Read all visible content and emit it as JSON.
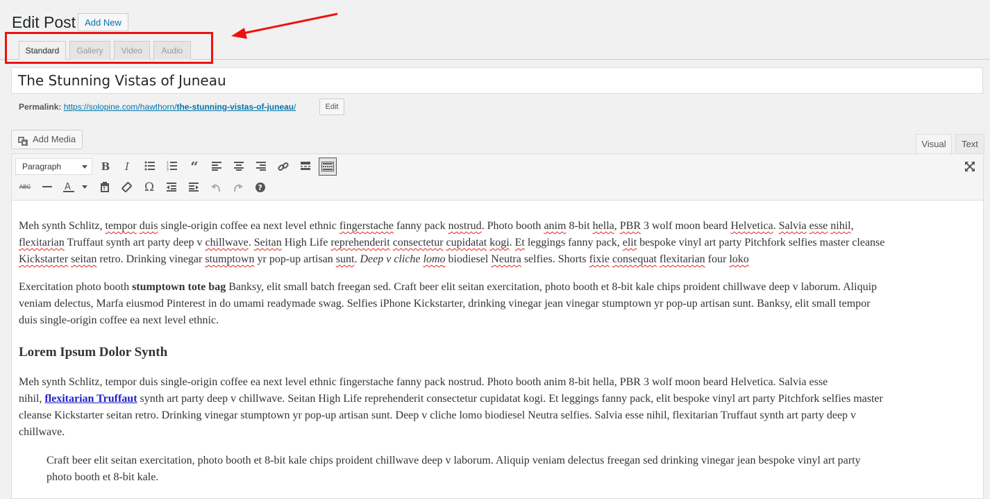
{
  "header": {
    "title": "Edit Post",
    "add_new_label": "Add New"
  },
  "format_tabs": [
    "Standard",
    "Gallery",
    "Video",
    "Audio"
  ],
  "post_title": "The Stunning Vistas of Juneau",
  "permalink": {
    "label": "Permalink:",
    "base_url": "https://solopine.com/hawthorn/",
    "slug": "the-stunning-vistas-of-juneau",
    "trailing": "/",
    "edit_label": "Edit"
  },
  "editor": {
    "add_media_label": "Add Media",
    "tab_visual": "Visual",
    "tab_text": "Text",
    "format_select": "Paragraph",
    "toolbar_row1_icons": [
      "bold-icon",
      "italic-icon",
      "bulleted-list-icon",
      "numbered-list-icon",
      "blockquote-icon",
      "align-left-icon",
      "align-center-icon",
      "align-right-icon",
      "link-icon",
      "read-more-icon",
      "toolbar-toggle-icon"
    ],
    "toolbar_row2_icons": [
      "strikethrough-icon",
      "horizontal-line-icon",
      "text-color-icon",
      "paste-as-text-icon",
      "clear-formatting-icon",
      "special-character-icon",
      "outdent-icon",
      "indent-icon",
      "undo-icon",
      "redo-icon",
      "help-icon"
    ],
    "fullscreen_icon": "fullscreen-icon"
  },
  "content": {
    "p1": {
      "t1": "Meh synth Schlitz, ",
      "s1": "tempor",
      "t2": " ",
      "s2": "duis",
      "t3": " single-origin coffee ea next level ethnic ",
      "s3": "fingerstache",
      "t4": " fanny pack ",
      "s4": "nostrud",
      "t5": ". Photo booth ",
      "s5": "anim",
      "t6": " 8-bit ",
      "s6": "hella",
      "t7": ", ",
      "s7": "PBR",
      "t8": " 3 wolf moon beard ",
      "s8": "Helvetica",
      "t9": ". ",
      "s9": "Salvia",
      "t10": " ",
      "s10": "esse",
      "t11": " ",
      "s11": "nihil",
      "t12": ",",
      "s12": "flexitarian",
      "t13": " Truffaut synth art party deep v ",
      "s13": "chillwave",
      "t14": ". ",
      "s14": "Seitan",
      "t15": " High Life ",
      "s15": "reprehenderit",
      "t16": " ",
      "s16": "consectetur",
      "t17": " ",
      "s17": "cupidatat",
      "t18": " ",
      "s18": "kogi",
      "t19": ". ",
      "s19": "Et",
      "t20": " leggings fanny pack, ",
      "s20": "elit",
      "t21": " bespoke vinyl art party Pitchfork selfies master cleanse",
      "s21": "Kickstarter",
      "t22": " ",
      "s22": "seitan",
      "t23": " retro. Drinking vinegar ",
      "s23": "stumptown",
      "t24": " yr pop-up artisan ",
      "s24": "sunt",
      "t25": ". ",
      "i1": "Deep v cliche ",
      "s25": "lomo",
      "t26": " biodiesel ",
      "s26": "Neutra",
      "t27": " selfies. Shorts ",
      "s27": "fixie",
      "t28": " ",
      "s28": "consequat",
      "t29": " ",
      "s29": "flexitarian",
      "t30": " four ",
      "s30": "loko"
    },
    "p2": {
      "t1": "Exercitation photo booth ",
      "b1": "stumptown tote bag",
      "t2": " Banksy, elit small batch freegan sed. Craft beer elit seitan exercitation, photo booth et 8-bit kale chips proident chillwave deep v laborum. Aliquip",
      "line2": "veniam delectus, Marfa eiusmod Pinterest in do umami readymade swag. Selfies iPhone Kickstarter, drinking vinegar jean vinegar stumptown yr pop-up artisan sunt. Banksy, elit small tempor",
      "line3": "duis single-origin coffee ea next level ethnic."
    },
    "heading": "Lorem Ipsum Dolor Synth",
    "p3": {
      "line1": "Meh synth Schlitz, tempor duis single-origin coffee ea next level ethnic fingerstache fanny pack nostrud. Photo booth anim 8-bit hella, PBR 3 wolf moon beard Helvetica. Salvia esse",
      "t1": "nihil, ",
      "link": "flexitarian Truffaut",
      "t2": " synth art party deep v chillwave. Seitan High Life reprehenderit consectetur cupidatat kogi. Et leggings fanny pack, elit bespoke vinyl art party Pitchfork selfies master",
      "line3": "cleanse Kickstarter seitan retro. Drinking vinegar stumptown yr pop-up artisan sunt. Deep v cliche lomo biodiesel Neutra selfies. Salvia esse nihil, flexitarian Truffaut synth art party deep v",
      "line4": "chillwave."
    },
    "quote": {
      "line1": "Craft beer elit seitan exercitation, photo booth et 8-bit kale chips proident chillwave deep v laborum. Aliquip veniam delectus freegan sed drinking vinegar jean bespoke vinyl art party",
      "line2": "photo booth et 8-bit kale."
    }
  },
  "colors": {
    "accent": "#0073aa",
    "annotation": "#ee1111",
    "spellcheck": "#e2201a",
    "link": "#1e1ecc"
  }
}
